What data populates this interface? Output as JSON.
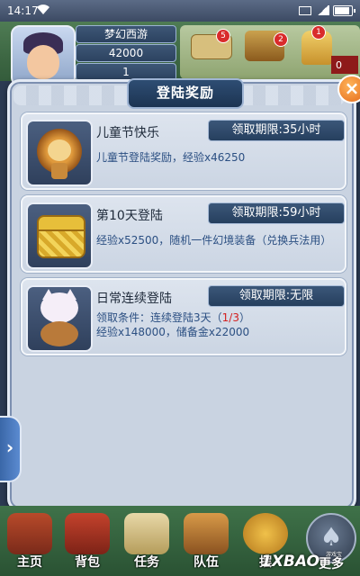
{
  "status_bar": {
    "time": "14:17"
  },
  "hud": {
    "player_name": "梦幻西游",
    "gold": "42000",
    "count": "1",
    "badge_1": "5",
    "badge_2": "2",
    "badge_3": "1",
    "right_value": "0"
  },
  "dialog": {
    "title": "登陆奖励",
    "close_label": "×",
    "rewards": [
      {
        "name": "儿童节快乐",
        "limit": "领取期限:35小时",
        "desc_line1": "儿童节登陆奖励，经验x46250",
        "icon": "lion-mascot-icon"
      },
      {
        "name": "第10天登陆",
        "limit": "领取期限:59小时",
        "desc_line1": "经验x52500，随机一件幻境装备（兑换兵法用）",
        "icon": "treasure-chest-icon"
      },
      {
        "name": "日常连续登陆",
        "limit": "领取期限:无限",
        "cond_prefix": "领取条件：连续登陆3天（",
        "cond_progress": "1/3",
        "cond_suffix": "）",
        "desc_line2": "经验x148000，储备金x22000",
        "icon": "cat-bag-icon"
      }
    ]
  },
  "bottom_nav": [
    {
      "label": "主页"
    },
    {
      "label": "背包"
    },
    {
      "label": "任务"
    },
    {
      "label": "队伍"
    },
    {
      "label": "摆"
    },
    {
      "label": "更多"
    }
  ],
  "watermark": {
    "text": "1XBAO",
    "sub": "游戏宝"
  }
}
